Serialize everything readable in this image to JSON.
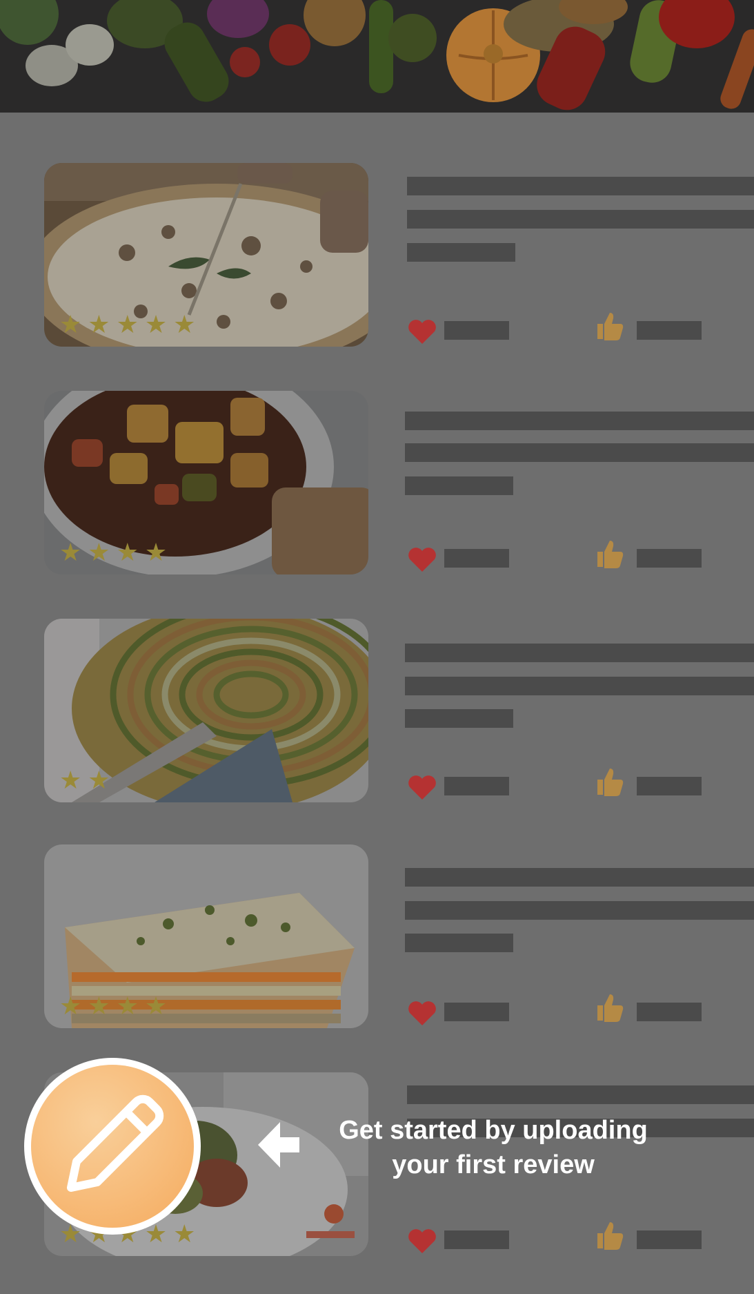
{
  "hero": {
    "image": "vegetables-banner"
  },
  "cards": [
    {
      "image": "pizza-photo",
      "rating": 5
    },
    {
      "image": "stew-photo",
      "rating": 4
    },
    {
      "image": "spiral-tart-photo",
      "rating": 2
    },
    {
      "image": "lasagna-photo",
      "rating": 4
    },
    {
      "image": "salad-plate-photo",
      "rating": 5
    }
  ],
  "icons": {
    "heart": "heart-icon",
    "like": "thumbs-up-icon",
    "compose": "pencil-icon",
    "pointer": "arrow-left-icon"
  },
  "colors": {
    "heart": "#b53232",
    "thumb": "#b58a45",
    "fab": "#f6b26a",
    "overlay": "#6e6e6e",
    "skeleton": "#4b4b4b",
    "star": "#9a8a38"
  },
  "onboarding": {
    "hint_line1": "Get started by uploading",
    "hint_line2": "your first review"
  }
}
